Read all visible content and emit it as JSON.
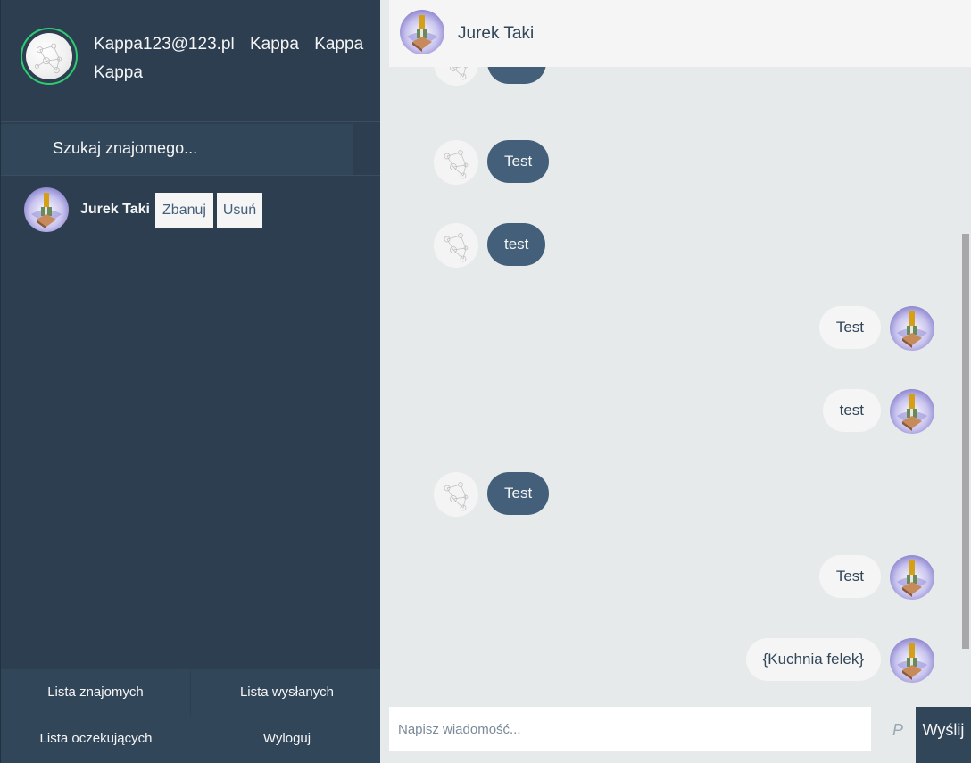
{
  "profile": {
    "name_line": "Kappa123@123.pl Kappa Kappa Kappa"
  },
  "search": {
    "placeholder": "Szukaj znajomego..."
  },
  "contacts": [
    {
      "name": "Jurek Taki",
      "ban_label": "Zbanuj",
      "delete_label": "Usuń"
    }
  ],
  "bottom_bar": {
    "friends_list": "Lista znajomych",
    "sent_list": "Lista wysłanych",
    "pending_list": "Lista oczekujących",
    "logout": "Wyloguj"
  },
  "chat_header": {
    "name": "Jurek Taki"
  },
  "messages": [
    {
      "type": "sent",
      "text": ""
    },
    {
      "type": "sent",
      "text": "Test"
    },
    {
      "type": "sent",
      "text": "test"
    },
    {
      "type": "reply",
      "text": "Test"
    },
    {
      "type": "reply",
      "text": "test"
    },
    {
      "type": "sent",
      "text": "Test"
    },
    {
      "type": "reply",
      "text": "Test"
    },
    {
      "type": "reply",
      "text": "{Kuchnia felek}"
    }
  ],
  "composer": {
    "placeholder": "Napisz wiadomość...",
    "attach_glyph": "P",
    "send_label": "Wyślij"
  },
  "icons": {
    "search": "search-icon",
    "attach": "paperclip-icon",
    "profile_avatar": "sketch-avatar-icon",
    "contact_avatar": "tool-avatar-icon"
  },
  "colors": {
    "sidebar": "#2c3e50",
    "sidebar_light": "#32465a",
    "sent_bubble": "#435f7a",
    "reply_bubble": "#f5f5f5",
    "online_ring": "#2ecc71",
    "chat_bg": "#e6eaea"
  }
}
